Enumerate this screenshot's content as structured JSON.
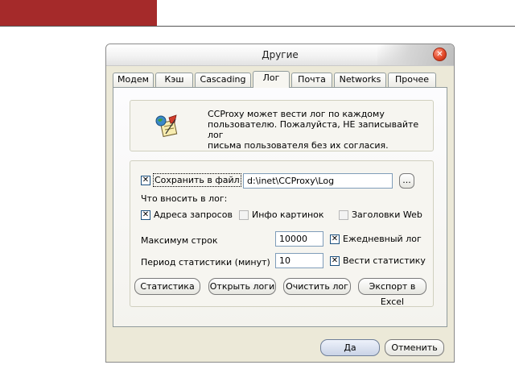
{
  "window": {
    "title": "Другие"
  },
  "tabs": [
    {
      "label": "Модем"
    },
    {
      "label": "Кэш"
    },
    {
      "label": "Cascading"
    },
    {
      "label": "Лог"
    },
    {
      "label": "Почта"
    },
    {
      "label": "Networks"
    },
    {
      "label": "Прочее"
    }
  ],
  "info": {
    "line1": "CCProxy может вести лог по каждому",
    "line2": "пользователю. Пожалуйста, НЕ записывайте лог",
    "line3": "письма пользователя без их согласия."
  },
  "save_to_file": {
    "label": "Сохранить в файл",
    "checked": true,
    "path": "d:\\inet\\CCProxy\\Log",
    "browse_label": "..."
  },
  "log_contents_label": "Что вносить в лог:",
  "options": {
    "request_addresses": {
      "label": "Адреса запросов",
      "checked": true
    },
    "image_info": {
      "label": "Инфо картинок",
      "checked": false
    },
    "web_headers": {
      "label": "Заголовки Web",
      "checked": false
    }
  },
  "max_lines": {
    "label": "Максимум строк",
    "value": "10000"
  },
  "daily_log": {
    "label": "Ежедневный лог",
    "checked": true
  },
  "stats_period": {
    "label": "Период статистики (минут)",
    "value": "10"
  },
  "keep_stats": {
    "label": "Вести статистику",
    "checked": true
  },
  "buttons": {
    "statistics": "Статистика",
    "open_logs": "Открыть логи",
    "clear_log": "Очистить лог",
    "export_excel": "Экспорт в Excel",
    "ok": "Да",
    "cancel": "Отменить"
  },
  "check_mark": "✕",
  "colors": {
    "banner": "#a52a2a",
    "close": "#e24a2a",
    "dialog_bg": "#ece9d8"
  }
}
